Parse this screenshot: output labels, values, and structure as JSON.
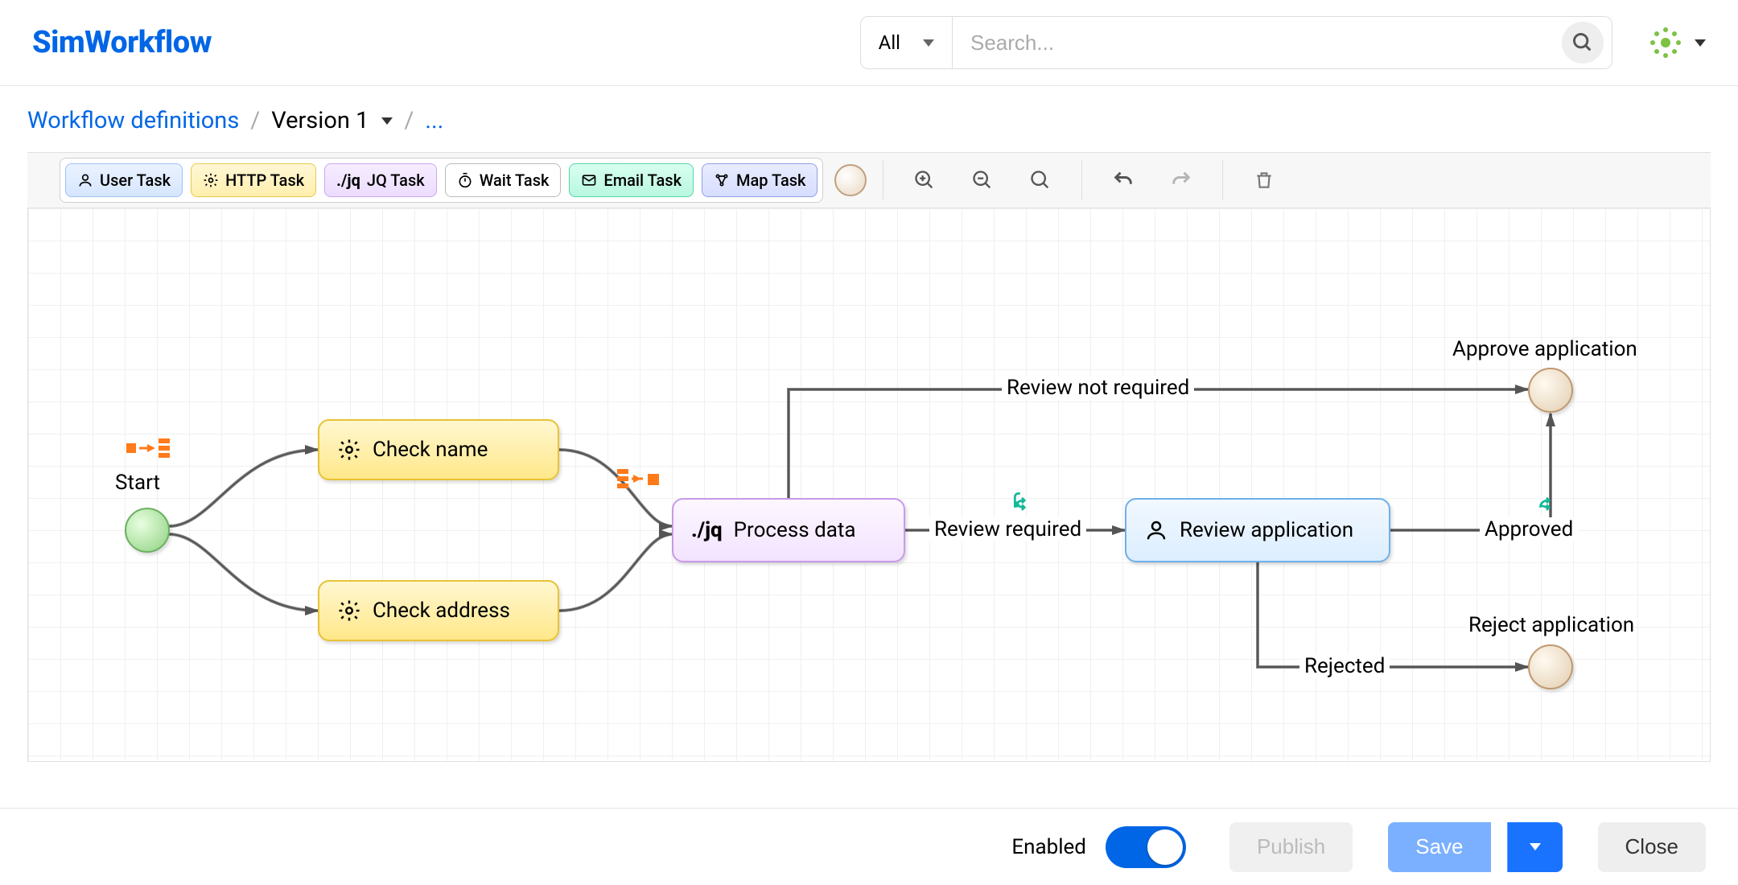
{
  "header": {
    "app_name": "SimWorkflow",
    "filter_label": "All",
    "search_placeholder": "Search..."
  },
  "breadcrumb": {
    "root": "Workflow definitions",
    "version": "Version 1",
    "ellipsis": "..."
  },
  "palette": {
    "user": "User Task",
    "http": "HTTP Task",
    "jq": "JQ Task",
    "wait": "Wait Task",
    "email": "Email Task",
    "map": "Map Task"
  },
  "canvas": {
    "start_label": "Start",
    "nodes": {
      "check_name": "Check name",
      "check_address": "Check address",
      "process_data": "Process data",
      "review_app": "Review application"
    },
    "edges": {
      "review_not_required": "Review not required",
      "review_required": "Review required",
      "approved": "Approved",
      "rejected": "Rejected"
    },
    "ends": {
      "approve": "Approve application",
      "reject": "Reject application"
    }
  },
  "footer": {
    "enabled_label": "Enabled",
    "enabled_state": true,
    "publish": "Publish",
    "save": "Save",
    "close": "Close"
  },
  "icons": {
    "jq_prefix": "./jq"
  }
}
